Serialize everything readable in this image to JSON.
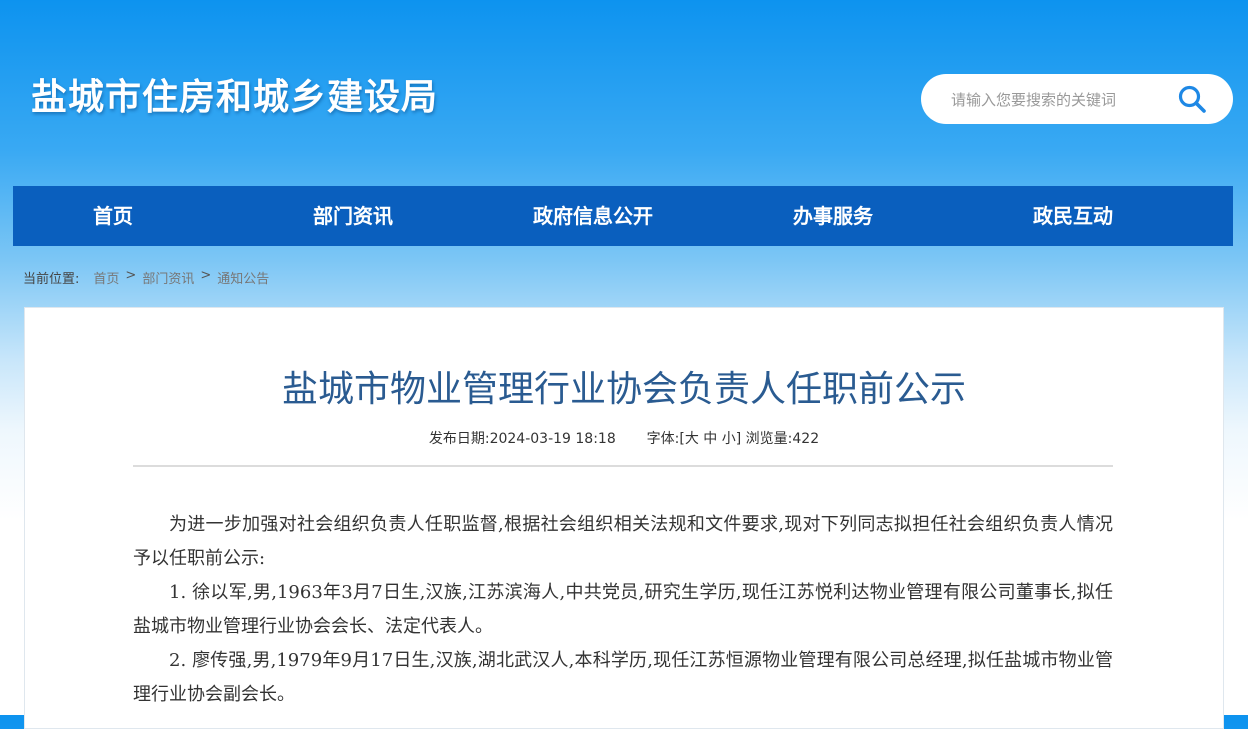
{
  "header": {
    "site_title": "盐城市住房和城乡建设局",
    "search_placeholder": "请输入您要搜索的关键词"
  },
  "nav": {
    "items": [
      {
        "label": "首页"
      },
      {
        "label": "部门资讯"
      },
      {
        "label": "政府信息公开"
      },
      {
        "label": "办事服务"
      },
      {
        "label": "政民互动"
      }
    ]
  },
  "breadcrumb": {
    "label": "当前位置:",
    "items": [
      "首页",
      "部门资讯",
      "通知公告"
    ],
    "separator": ">"
  },
  "article": {
    "title": "盐城市物业管理行业协会负责人任职前公示",
    "publish_label": "发布日期:",
    "publish_date": "2024-03-19 18:18",
    "font_label": "字体:",
    "font_open": "[",
    "font_large": "大",
    "font_medium": "中",
    "font_small": "小",
    "font_close": "]",
    "views_label": "浏览量:",
    "views": "422",
    "paragraphs": [
      "为进一步加强对社会组织负责人任职监督,根据社会组织相关法规和文件要求,现对下列同志拟担任社会组织负责人情况予以任职前公示:",
      "1. 徐以军,男,1963年3月7日生,汉族,江苏滨海人,中共党员,研究生学历,现任江苏悦利达物业管理有限公司董事长,拟任盐城市物业管理行业协会会长、法定代表人。",
      "2. 廖传强,男,1979年9月17日生,汉族,湖北武汉人,本科学历,现任江苏恒源物业管理有限公司总经理,拟任盐城市物业管理行业协会副会长。"
    ]
  },
  "colors": {
    "nav_bg": "#0a5fbe",
    "title_color": "#2a5b91",
    "search_icon": "#1e88e5"
  }
}
